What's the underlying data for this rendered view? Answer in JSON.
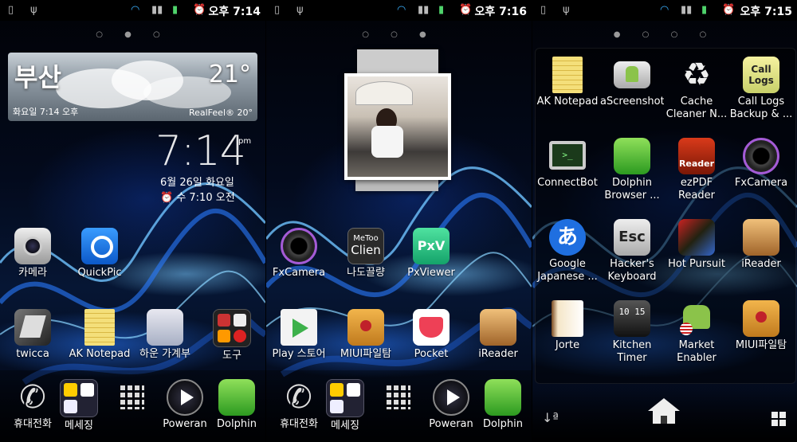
{
  "status": {
    "screen1_time": "오후 7:14",
    "screen2_time": "오후 7:16",
    "screen3_time": "오후 7:15"
  },
  "screen1": {
    "page_dots": "○ ● ○",
    "weather": {
      "city": "부산",
      "temp": "21°",
      "date": "화요일 7:14 오후",
      "realfeel": "RealFeel® 20°"
    },
    "clock": {
      "time": "7:14",
      "ampm": "pm",
      "date": "6월 26일 화요일",
      "alarm": "⏰ 수 7:10 오전"
    },
    "apps": [
      {
        "label": "카메라",
        "icon": "camera-icon"
      },
      {
        "label": "QuickPic",
        "icon": "quickpic-icon"
      },
      {
        "label": "twicca",
        "icon": "twicca-icon"
      },
      {
        "label": "AK Notepad",
        "icon": "notepad-icon"
      },
      {
        "label": "하운 가계부",
        "icon": "account-book-icon"
      },
      {
        "label": "도구",
        "icon": "tools-folder-icon"
      }
    ],
    "dock": [
      {
        "label": "휴대전화",
        "icon": "phone-icon"
      },
      {
        "label": "메세징",
        "icon": "messaging-folder-icon"
      },
      {
        "label": "",
        "icon": "app-drawer-icon"
      },
      {
        "label": "Poweran",
        "icon": "poweramp-icon"
      },
      {
        "label": "Dolphin",
        "icon": "dolphin-icon"
      }
    ]
  },
  "screen2": {
    "page_dots": "○ ○ ●",
    "apps": [
      {
        "label": "FxCamera",
        "icon": "fxcamera-icon"
      },
      {
        "label": "나도끌량",
        "icon": "metoo-clien-icon",
        "icon_text1": "MeToo",
        "icon_text2": "Clien"
      },
      {
        "label": "PxViewer",
        "icon": "pxviewer-icon",
        "icon_text": "PxV"
      },
      {
        "label": "Play 스토어",
        "icon": "play-store-icon"
      },
      {
        "label": "MIUI파일탐",
        "icon": "miui-file-icon"
      },
      {
        "label": "Pocket",
        "icon": "pocket-icon"
      },
      {
        "label": "iReader",
        "icon": "ireader-icon"
      }
    ],
    "dock": [
      {
        "label": "휴대전화",
        "icon": "phone-icon"
      },
      {
        "label": "메세징",
        "icon": "messaging-folder-icon"
      },
      {
        "label": "",
        "icon": "app-drawer-icon"
      },
      {
        "label": "Poweran",
        "icon": "poweramp-icon"
      },
      {
        "label": "Dolphin",
        "icon": "dolphin-icon"
      }
    ]
  },
  "screen3": {
    "page_dots": "● ○ ○ ○",
    "apps": [
      {
        "label": "AK Notepad",
        "icon": "notepad-icon"
      },
      {
        "label": "aScreenshot",
        "icon": "ascreenshot-icon"
      },
      {
        "label": "Cache Cleaner N...",
        "icon": "recycle-icon"
      },
      {
        "label": "Call Logs Backup & ...",
        "icon": "call-logs-icon",
        "icon_text": "Call Logs"
      },
      {
        "label": "ConnectBot",
        "icon": "terminal-icon"
      },
      {
        "label": "Dolphin Browser ...",
        "icon": "dolphin-icon"
      },
      {
        "label": "ezPDF Reader",
        "icon": "ezpdf-icon",
        "icon_text": "Reader"
      },
      {
        "label": "FxCamera",
        "icon": "fxcamera-icon"
      },
      {
        "label": "Google Japanese ...",
        "icon": "google-japanese-icon",
        "icon_text": "あ"
      },
      {
        "label": "Hacker's Keyboard",
        "icon": "esc-key-icon",
        "icon_text": "Esc"
      },
      {
        "label": "Hot Pursuit",
        "icon": "hot-pursuit-icon"
      },
      {
        "label": "iReader",
        "icon": "ireader-icon"
      },
      {
        "label": "Jorte",
        "icon": "jorte-icon"
      },
      {
        "label": "Kitchen Timer",
        "icon": "kitchen-timer-icon",
        "icon_text": "10 15"
      },
      {
        "label": "Market Enabler",
        "icon": "market-enabler-icon"
      },
      {
        "label": "MIUI파일탐",
        "icon": "miui-file-icon"
      }
    ],
    "bottom": {
      "sort_icon": "sort-icon",
      "home_icon": "home-icon",
      "grid_icon": "grid-icon"
    }
  }
}
